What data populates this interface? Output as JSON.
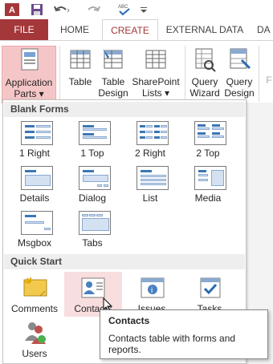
{
  "qat": {
    "icons": [
      "access-app-icon",
      "save-icon",
      "undo-icon",
      "redo-icon",
      "spelling-icon",
      "customize-icon"
    ],
    "app_icon_letter": "A"
  },
  "tabs": {
    "file": "FILE",
    "home": "HOME",
    "create": "CREATE",
    "external": "EXTERNAL DATA",
    "cutoff": "DA"
  },
  "ribbon": {
    "app_parts": [
      "Application",
      "Parts ▾"
    ],
    "table": "Table",
    "table_design": [
      "Table",
      "Design"
    ],
    "sharepoint": [
      "SharePoint",
      "Lists ▾"
    ],
    "query_wizard": [
      "Query",
      "Wizard"
    ],
    "query_design": [
      "Query",
      "Design"
    ],
    "cutoff": "F"
  },
  "panel": {
    "blank_forms": "Blank Forms",
    "blank_items": [
      "1 Right",
      "1 Top",
      "2 Right",
      "2 Top",
      "Details",
      "Dialog",
      "List",
      "Media",
      "Msgbox",
      "Tabs"
    ],
    "quick_start": "Quick Start",
    "quick_items": [
      "Comments",
      "Contacts",
      "Issues",
      "Tasks",
      "Users"
    ]
  },
  "tooltip": {
    "title": "Contacts",
    "body": "Contacts table with forms and reports."
  },
  "colors": {
    "accent": "#a4373a",
    "highlight": "#f5c6c7"
  }
}
